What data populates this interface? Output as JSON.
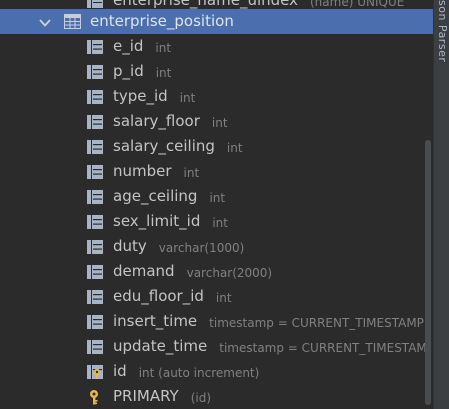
{
  "top_partial": {
    "name": "enterprise_name_uindex",
    "type": "(name) UNIQUE"
  },
  "table": {
    "name": "enterprise_position"
  },
  "columns": [
    {
      "name": "e_id",
      "type": "int",
      "icon": "column-icon"
    },
    {
      "name": "p_id",
      "type": "int",
      "icon": "column-icon"
    },
    {
      "name": "type_id",
      "type": "int",
      "icon": "column-icon"
    },
    {
      "name": "salary_floor",
      "type": "int",
      "icon": "column-icon"
    },
    {
      "name": "salary_ceiling",
      "type": "int",
      "icon": "column-icon"
    },
    {
      "name": "number",
      "type": "int",
      "icon": "column-icon"
    },
    {
      "name": "age_ceiling",
      "type": "int",
      "icon": "column-icon"
    },
    {
      "name": "sex_limit_id",
      "type": "int",
      "icon": "column-icon"
    },
    {
      "name": "duty",
      "type": "varchar(1000)",
      "icon": "column-icon"
    },
    {
      "name": "demand",
      "type": "varchar(2000)",
      "icon": "column-icon"
    },
    {
      "name": "edu_floor_id",
      "type": "int",
      "icon": "column-icon"
    },
    {
      "name": "insert_time",
      "type": "timestamp = CURRENT_TIMESTAMP",
      "icon": "column-icon"
    },
    {
      "name": "update_time",
      "type": "timestamp = CURRENT_TIMESTAM",
      "icon": "column-icon"
    },
    {
      "name": "id",
      "type": "int (auto increment)",
      "icon": "primary-key-column-icon"
    }
  ],
  "keys": [
    {
      "name": "PRIMARY",
      "type": "(id)",
      "icon": "key-icon"
    }
  ],
  "side_tab": {
    "label": "son Parser"
  },
  "colors": {
    "selection": "#4b6eaf",
    "background": "#2b2b2b",
    "key": "#e8b84a"
  }
}
